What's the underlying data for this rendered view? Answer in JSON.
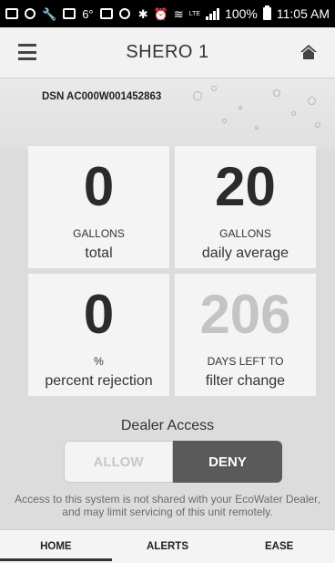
{
  "status_bar": {
    "battery": "100%",
    "time": "11:05 AM",
    "icons": [
      "message-icon",
      "chat-icon",
      "wrench-icon",
      "image-icon",
      "temperature-icon",
      "gallery-icon",
      "app-icon",
      "bluetooth-icon",
      "alarm-icon",
      "wifi-icon",
      "lte-icon",
      "signal-icon",
      "battery-icon"
    ],
    "temperature_small": "6°",
    "lte_label": "LTE"
  },
  "header": {
    "title": "SHERO 1",
    "menu_icon": "menu-icon",
    "home_icon": "home-icon"
  },
  "device": {
    "dsn": "DSN AC000W001452863"
  },
  "tiles": [
    {
      "value": "0",
      "unit": "GALLONS",
      "label": "total",
      "muted": false
    },
    {
      "value": "20",
      "unit": "GALLONS",
      "label": "daily average",
      "muted": false
    },
    {
      "value": "0",
      "unit": "%",
      "label": "percent rejection",
      "muted": false
    },
    {
      "value": "206",
      "unit": "DAYS LEFT TO",
      "label": "filter change",
      "muted": true
    }
  ],
  "dealer_access": {
    "title": "Dealer Access",
    "allow_label": "ALLOW",
    "deny_label": "DENY",
    "selected": "DENY",
    "notice": "Access to this system is not shared with your EcoWater Dealer, and may limit servicing of this unit remotely."
  },
  "tabs": [
    {
      "label": "HOME",
      "active": true
    },
    {
      "label": "ALERTS",
      "active": false
    },
    {
      "label": "EASE",
      "active": false
    }
  ],
  "colors": {
    "active_toggle": "#5a5a5a",
    "muted_value": "#c4c4c4",
    "background": "#dcdcdc"
  }
}
